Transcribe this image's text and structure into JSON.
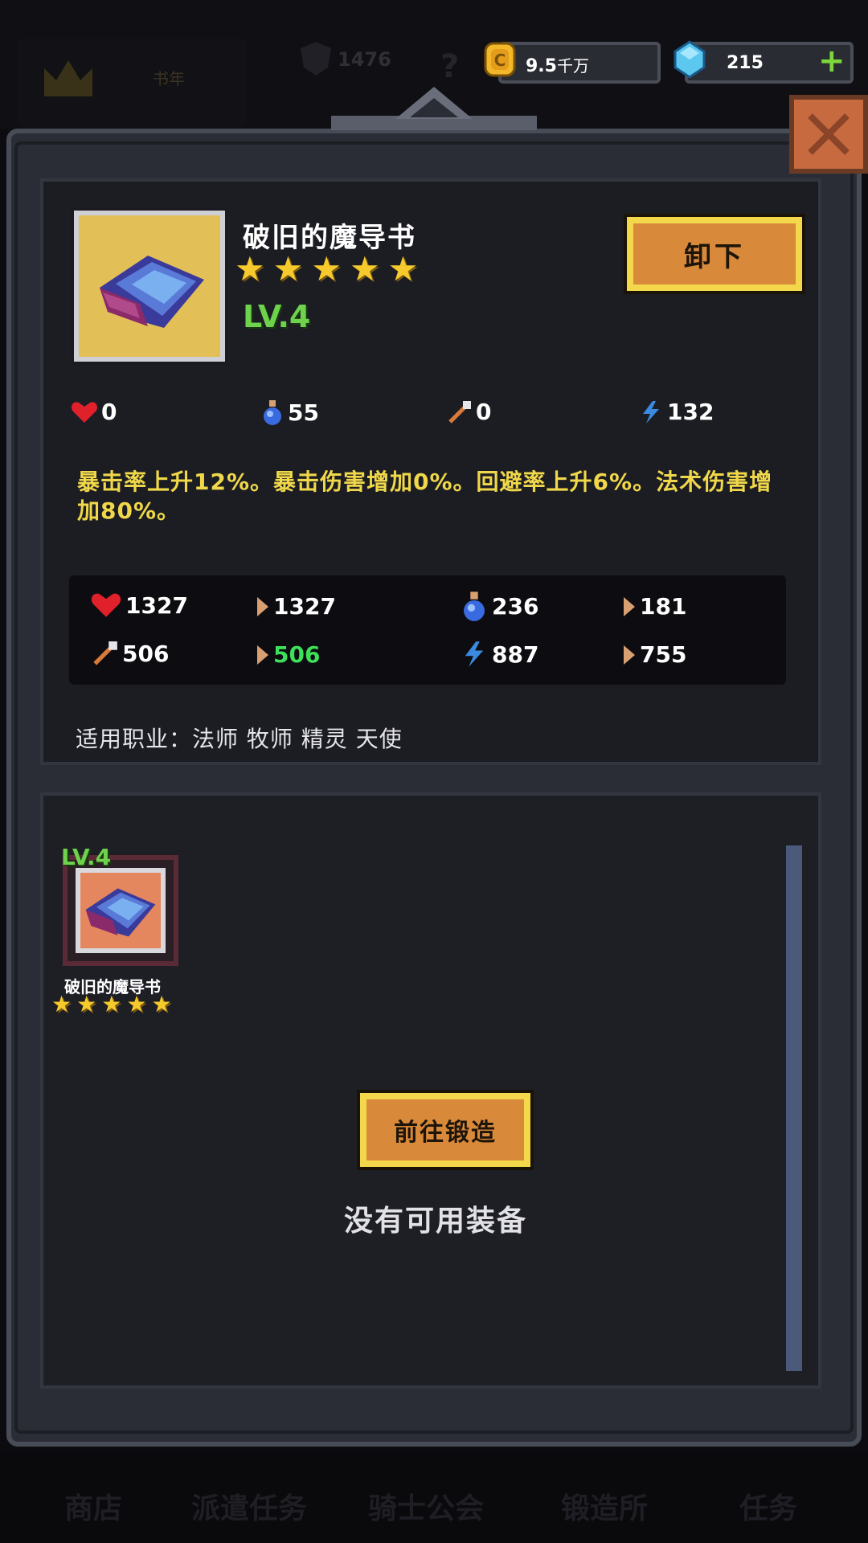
{
  "background": {
    "badge_value": "1476",
    "bottom_tabs": [
      "商店",
      "派遣任务",
      "骑士公会",
      "锻造所",
      "任务"
    ]
  },
  "currency": {
    "gold": {
      "value": "9.5",
      "unit": "千万",
      "icon": "coin-icon"
    },
    "gems": {
      "value": "215",
      "icon": "gem-icon"
    },
    "add_icon": "plus-icon"
  },
  "detail": {
    "item_name": "破旧的魔导书",
    "stars": 5,
    "level": "LV.4",
    "unequip_label": "卸下",
    "item_stats": [
      {
        "icon": "heart-icon",
        "value": "0"
      },
      {
        "icon": "potion-icon",
        "value": "55"
      },
      {
        "icon": "sword-icon",
        "value": "0"
      },
      {
        "icon": "lightning-icon",
        "value": "132"
      }
    ],
    "description": "暴击率上升12%。暴击伤害增加0%。回避率上升6%。法术伤害增加80%。",
    "total_stats": [
      {
        "icon": "heart-icon",
        "value": "1327",
        "bonus": "1327"
      },
      {
        "icon": "potion-icon",
        "value": "236",
        "bonus": "181"
      },
      {
        "icon": "sword-icon",
        "value": "506",
        "bonus": "506"
      },
      {
        "icon": "lightning-icon",
        "value": "887",
        "bonus": "755"
      }
    ],
    "classes": "适用职业：法师 牧师 精灵 天使"
  },
  "inventory": {
    "slot": {
      "level": "LV.4",
      "name": "破旧的魔导书",
      "stars": 5
    },
    "forge_label": "前往锻造",
    "empty_text": "没有可用装备"
  },
  "colors": {
    "gold_text": "#f0d84a",
    "green_text": "#6fd24c",
    "bonus_green": "#3ee05a",
    "button_fill": "#d9893a",
    "button_border": "#f2d84a"
  }
}
